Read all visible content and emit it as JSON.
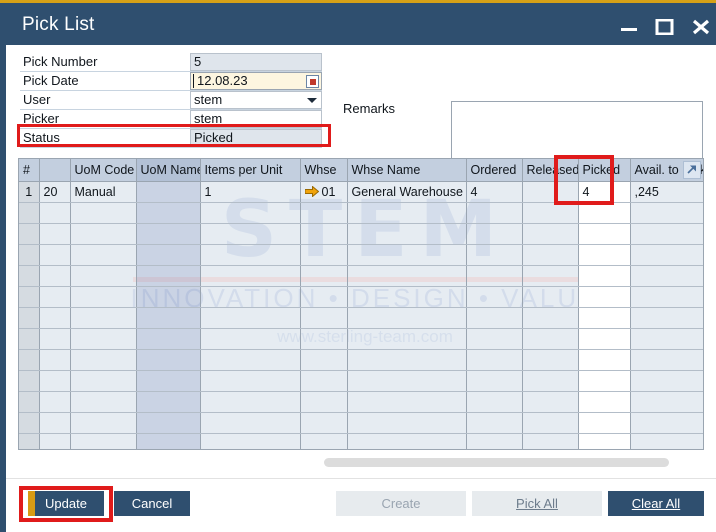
{
  "window": {
    "title": "Pick List",
    "accent_top_color": "#d6a117",
    "titlebar_color": "#2f4f6f",
    "controls": [
      {
        "name": "minimize",
        "glyph": "minimize-icon"
      },
      {
        "name": "maximize",
        "glyph": "maximize-icon"
      },
      {
        "name": "close",
        "glyph": "close-icon"
      }
    ]
  },
  "form": {
    "fields": [
      {
        "label": "Pick Number",
        "value": "5",
        "type": "readonly"
      },
      {
        "label": "Pick Date",
        "value": "12.08.23",
        "type": "date"
      },
      {
        "label": "User",
        "value": "stem",
        "type": "select"
      },
      {
        "label": "Picker",
        "value": "stem",
        "type": "text"
      },
      {
        "label": "Status",
        "value": "Picked",
        "type": "readonly"
      }
    ],
    "remarks_label": "Remarks",
    "remarks_value": ""
  },
  "grid": {
    "columns": [
      "#",
      "",
      "UoM Code",
      "UoM Name",
      "Items per Unit",
      "Whse",
      "Whse Name",
      "Ordered",
      "Released",
      "Picked",
      "Avail. to Pick"
    ],
    "expand_icon": "expand-link-icon",
    "rows": [
      {
        "num": "1",
        "col2": "20",
        "uom_code": "Manual",
        "uom_name": "",
        "items_per_unit": "1",
        "whse": "01",
        "whse_icon": "orange-arrow-icon",
        "whse_name": "General Warehouse",
        "ordered": "4",
        "released": "",
        "picked": "4",
        "avail_to_pick": ",245"
      }
    ],
    "empty_row_count": 12
  },
  "watermark": {
    "main": "STEM",
    "registered": "®",
    "subtitle": "INNOVATION • DESIGN • VALUE",
    "url": "www.sterling-team.com"
  },
  "footer": {
    "update_label": "Update",
    "cancel_label": "Cancel",
    "create_label": "Create",
    "pick_all_label": "Pick All",
    "clear_all_label": "Clear All"
  },
  "highlights": {
    "color": "#e01b1b",
    "targets": [
      "status-row",
      "picked-column",
      "update-button"
    ]
  }
}
